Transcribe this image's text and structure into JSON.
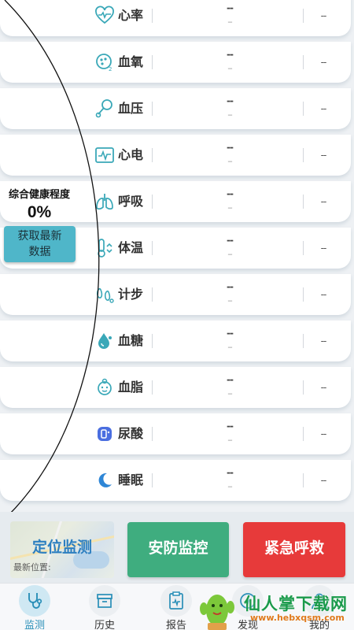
{
  "metrics": [
    {
      "label": "心率",
      "icon": "heart-rate-icon",
      "value_top": "--",
      "value_bottom": "--",
      "value_right": "--"
    },
    {
      "label": "血氧",
      "icon": "blood-oxygen-icon",
      "value_top": "--",
      "value_bottom": "--",
      "value_right": "--"
    },
    {
      "label": "血压",
      "icon": "blood-pressure-icon",
      "value_top": "--",
      "value_bottom": "--",
      "value_right": "--"
    },
    {
      "label": "心电",
      "icon": "ecg-icon",
      "value_top": "--",
      "value_bottom": "--",
      "value_right": "--"
    },
    {
      "label": "呼吸",
      "icon": "lungs-icon",
      "value_top": "--",
      "value_bottom": "--",
      "value_right": "--"
    },
    {
      "label": "体温",
      "icon": "thermometer-icon",
      "value_top": "--",
      "value_bottom": "--",
      "value_right": "--"
    },
    {
      "label": "计步",
      "icon": "footprint-icon",
      "value_top": "--",
      "value_bottom": "--",
      "value_right": "--"
    },
    {
      "label": "血糖",
      "icon": "blood-drop-icon",
      "value_top": "--",
      "value_bottom": "--",
      "value_right": "--"
    },
    {
      "label": "血脂",
      "icon": "blood-lipid-icon",
      "value_top": "--",
      "value_bottom": "--",
      "value_right": "--"
    },
    {
      "label": "尿酸",
      "icon": "uric-acid-icon",
      "value_top": "--",
      "value_bottom": "--",
      "value_right": "--"
    },
    {
      "label": "睡眠",
      "icon": "moon-icon",
      "value_top": "--",
      "value_bottom": "--",
      "value_right": "--"
    }
  ],
  "health": {
    "title": "综合健康程度",
    "percent": "0%",
    "refresh_label_line1": "获取最新",
    "refresh_label_line2": "数据"
  },
  "actions": {
    "location": "定位监测",
    "location_sub": "最新位置:",
    "security": "安防监控",
    "sos": "紧急呼救"
  },
  "nav": [
    {
      "label": "监测",
      "icon": "stethoscope-icon",
      "active": true
    },
    {
      "label": "历史",
      "icon": "archive-box-icon",
      "active": false
    },
    {
      "label": "报告",
      "icon": "report-icon",
      "active": false
    },
    {
      "label": "发现",
      "icon": "discover-icon",
      "active": false
    },
    {
      "label": "我的",
      "icon": "profile-icon",
      "active": false
    }
  ],
  "watermark": {
    "text": "仙人掌下载网",
    "url": "www.hebxqsm.com"
  },
  "colors": {
    "accent": "#2a8fb8",
    "icon_teal": "#3aa8b8",
    "security_green": "#3fad7f",
    "sos_red": "#e73a3a",
    "refresh_button": "#4fb6c9",
    "uric_acid_blue": "#4a6ee0"
  }
}
